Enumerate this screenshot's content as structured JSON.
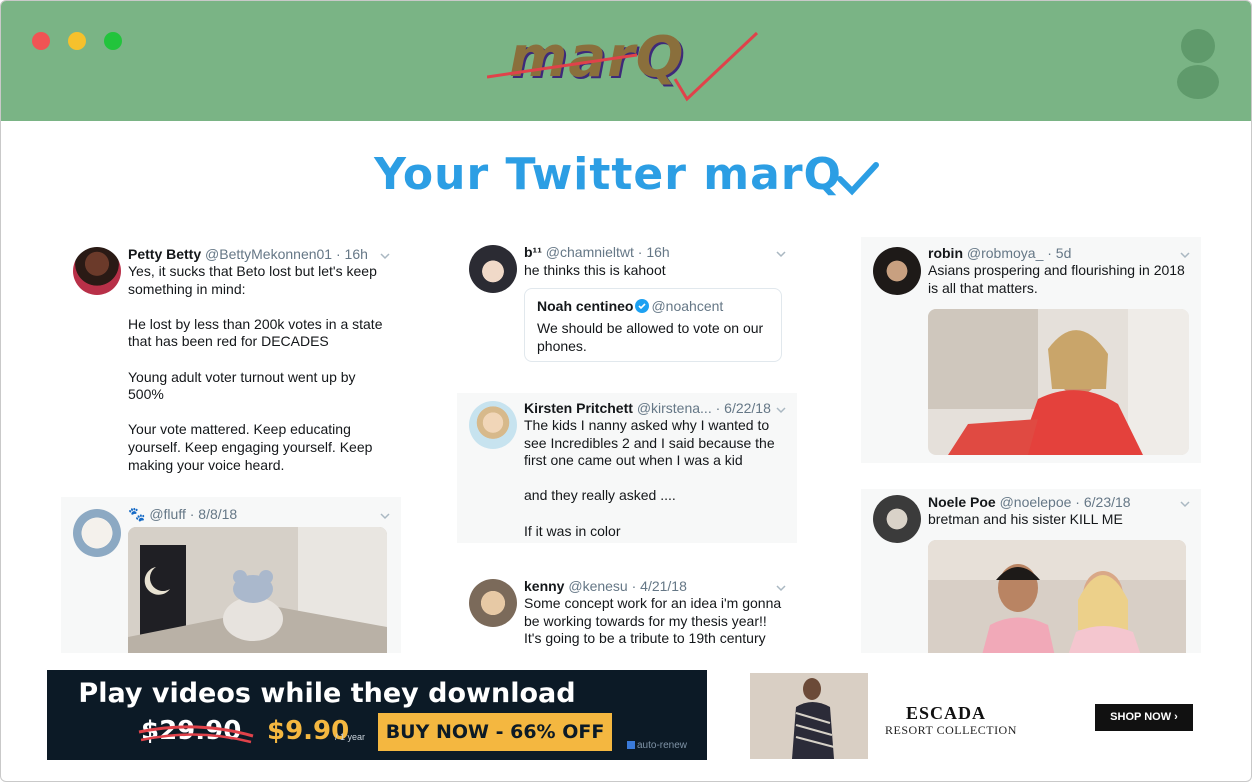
{
  "app": {
    "logo_text": "marQ",
    "page_title": "Your Twitter marQ"
  },
  "colors": {
    "header_bg": "#7ab485",
    "title_blue": "#2c9ee4",
    "logo_brown": "#8a6f3c",
    "logo_red": "#e0424a"
  },
  "tweets": {
    "betty": {
      "name": "Petty Betty",
      "meta": "@BettyMekonnen01 · 16h",
      "text": "Yes, it sucks that Beto lost but let's keep something in mind:\n\nHe lost by less than 200k votes in a state that has been red for DECADES\n\nYoung adult voter turnout went up by 500%\n\nYour vote mattered. Keep educating yourself. Keep engaging yourself. Keep making your voice heard."
    },
    "fluff": {
      "name": "🐾",
      "meta": "@fluff · 8/8/18"
    },
    "b11": {
      "name": "b¹¹",
      "meta": "@chamnieltwt · 16h",
      "text": "he thinks this is kahoot",
      "quote_name": "Noah centineo",
      "quote_handle": "@noahcent",
      "quote_text": "We should be allowed to vote on our phones."
    },
    "kirsten": {
      "name": "Kirsten Pritchett",
      "meta": "@kirstena... · 6/22/18",
      "text": "The kids I nanny asked why I wanted to see Incredibles 2 and I said because the first one came out when I was a kid\n\nand they really asked ....\n\nIf it was in color"
    },
    "kenny": {
      "name": "kenny",
      "meta": "@kenesu · 4/21/18",
      "text": "Some concept work for an idea i'm gonna be working towards for my thesis year!! It's going to be a tribute to 19th century"
    },
    "robin": {
      "name": "robin",
      "meta": "@robmoya_ · 5d",
      "text": "Asians prospering and flourishing in 2018 is all that matters."
    },
    "noele": {
      "name": "Noele Poe",
      "meta": "@noelepoe · 6/23/18",
      "text": "bretman and his sister KILL ME"
    }
  },
  "ads": {
    "left": {
      "headline": "Play videos while they download",
      "old_price": "$29.90",
      "new_price": "$9.90",
      "per": "/ 1 year",
      "button": "BUY NOW - 66% OFF",
      "renew": "auto-renew"
    },
    "right": {
      "brand": "ESCADA",
      "sub": "RESORT COLLECTION",
      "button": "SHOP NOW ›"
    }
  }
}
